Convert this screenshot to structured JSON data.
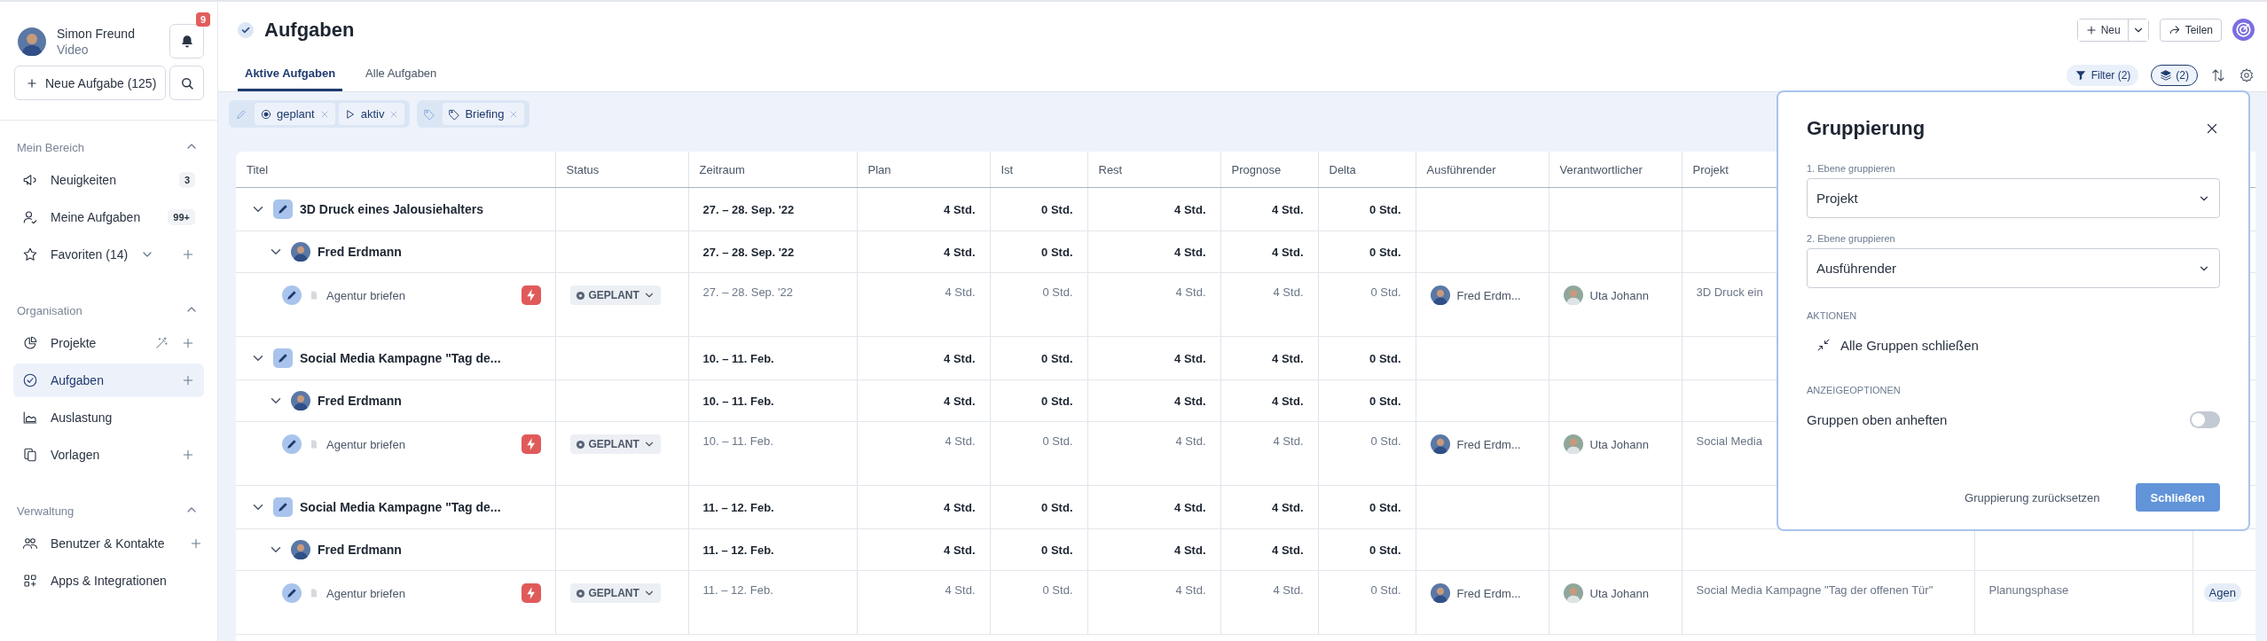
{
  "user": {
    "name": "Simon Freund",
    "subtitle": "Video"
  },
  "notifications": {
    "count": "9"
  },
  "new_task_button": "Neue Aufgabe (125)",
  "sidebar": {
    "sections": [
      {
        "title": "Mein Bereich",
        "expanded": true,
        "items": [
          {
            "label": "Neuigkeiten",
            "badge": "3",
            "add": false,
            "selected": false
          },
          {
            "label": "Meine Aufgaben",
            "badge": "99+",
            "add": false,
            "selected": false
          },
          {
            "label": "Favoriten (14)",
            "add": true,
            "selected": false
          }
        ]
      },
      {
        "title": "Organisation",
        "expanded": true,
        "items": [
          {
            "label": "Projekte",
            "add": true,
            "selected": false
          },
          {
            "label": "Aufgaben",
            "add": true,
            "selected": true
          },
          {
            "label": "Auslastung",
            "add": false,
            "selected": false
          },
          {
            "label": "Vorlagen",
            "add": true,
            "selected": false
          }
        ]
      },
      {
        "title": "Verwaltung",
        "expanded": true,
        "items": [
          {
            "label": "Benutzer & Kontakte",
            "add": true,
            "selected": false
          },
          {
            "label": "Apps & Integrationen",
            "add": false,
            "selected": false
          }
        ]
      }
    ]
  },
  "page": {
    "title": "Aufgaben",
    "new_button": "Neu",
    "share_button": "Teilen"
  },
  "tabs": [
    {
      "label": "Aktive Aufgaben",
      "selected": true
    },
    {
      "label": "Alle Aufgaben",
      "selected": false
    }
  ],
  "toolbar": {
    "filter_button": "Filter (2)",
    "grouping_button": {
      "label": "(2)",
      "open": true
    }
  },
  "filters": [
    {
      "chips": [
        "geplant",
        "aktiv"
      ]
    },
    {
      "chips": [
        "Briefing"
      ]
    }
  ],
  "table": {
    "columns": [
      "Titel",
      "Status",
      "Zeitraum",
      "Plan",
      "Ist",
      "Rest",
      "Prognose",
      "Delta",
      "Ausführender",
      "Verantwortlicher",
      "Projekt"
    ],
    "groups": [
      {
        "title": "3D Druck eines Jalousiehalters",
        "expanded": true,
        "period": "27. – 28. Sep. '22",
        "plan": "4 Std.",
        "ist": "0 Std.",
        "rest": "4 Std.",
        "prognose": "4 Std.",
        "delta": "0 Std.",
        "assignees": [
          {
            "name": "Fred Erdmann",
            "expanded": true,
            "period": "27. – 28. Sep. '22",
            "plan": "4 Std.",
            "ist": "0 Std.",
            "rest": "4 Std.",
            "prognose": "4 Std.",
            "delta": "0 Std.",
            "tasks": [
              {
                "title": "Agentur briefen",
                "status": "GEPLANT",
                "period": "27. – 28. Sep. '22",
                "plan": "4 Std.",
                "ist": "0 Std.",
                "rest": "4 Std.",
                "prognose": "4 Std.",
                "delta": "0 Std.",
                "assignee": "Fred Erdm...",
                "responsible": "Uta Johann",
                "project": "3D Druck ein"
              }
            ]
          }
        ]
      },
      {
        "title": "Social Media Kampagne \"Tag de...",
        "expanded": true,
        "period": "10. – 11. Feb.",
        "plan": "4 Std.",
        "ist": "0 Std.",
        "rest": "4 Std.",
        "prognose": "4 Std.",
        "delta": "0 Std.",
        "assignees": [
          {
            "name": "Fred Erdmann",
            "expanded": true,
            "period": "10. – 11. Feb.",
            "plan": "4 Std.",
            "ist": "0 Std.",
            "rest": "4 Std.",
            "prognose": "4 Std.",
            "delta": "0 Std.",
            "tasks": [
              {
                "title": "Agentur briefen",
                "status": "GEPLANT",
                "period": "10. – 11. Feb.",
                "plan": "4 Std.",
                "ist": "0 Std.",
                "rest": "4 Std.",
                "prognose": "4 Std.",
                "delta": "0 Std.",
                "assignee": "Fred Erdm...",
                "responsible": "Uta Johann",
                "project": "Social Media"
              }
            ]
          }
        ]
      },
      {
        "title": "Social Media Kampagne \"Tag de...",
        "expanded": true,
        "period": "11. – 12. Feb.",
        "plan": "4 Std.",
        "ist": "0 Std.",
        "rest": "4 Std.",
        "prognose": "4 Std.",
        "delta": "0 Std.",
        "assignees": [
          {
            "name": "Fred Erdmann",
            "expanded": true,
            "period": "11. – 12. Feb.",
            "plan": "4 Std.",
            "ist": "0 Std.",
            "rest": "4 Std.",
            "prognose": "4 Std.",
            "delta": "0 Std.",
            "tasks": [
              {
                "title": "Agentur briefen",
                "status": "GEPLANT",
                "period": "11. – 12. Feb.",
                "plan": "4 Std.",
                "ist": "0 Std.",
                "rest": "4 Std.",
                "prognose": "4 Std.",
                "delta": "0 Std.",
                "assignee": "Fred Erdm...",
                "responsible": "Uta Johann",
                "project": "Social Media Kampagne \"Tag der offenen Tür\"",
                "column_12": "Planungsphase",
                "column_13": "Agen"
              }
            ]
          }
        ]
      }
    ]
  },
  "grouping_panel": {
    "title": "Gruppierung",
    "fields": [
      {
        "label": "1. Ebene gruppieren",
        "value": "Projekt"
      },
      {
        "label": "2. Ebene gruppieren",
        "value": "Ausführender"
      }
    ],
    "actions_heading": "AKTIONEN",
    "collapse_action": "Alle Gruppen schließen",
    "display_heading": "ANZEIGEOPTIONEN",
    "pin_option": {
      "label": "Gruppen oben anheften",
      "on": false
    },
    "reset_button": "Gruppierung zurücksetzen",
    "close_button": "Schließen"
  }
}
